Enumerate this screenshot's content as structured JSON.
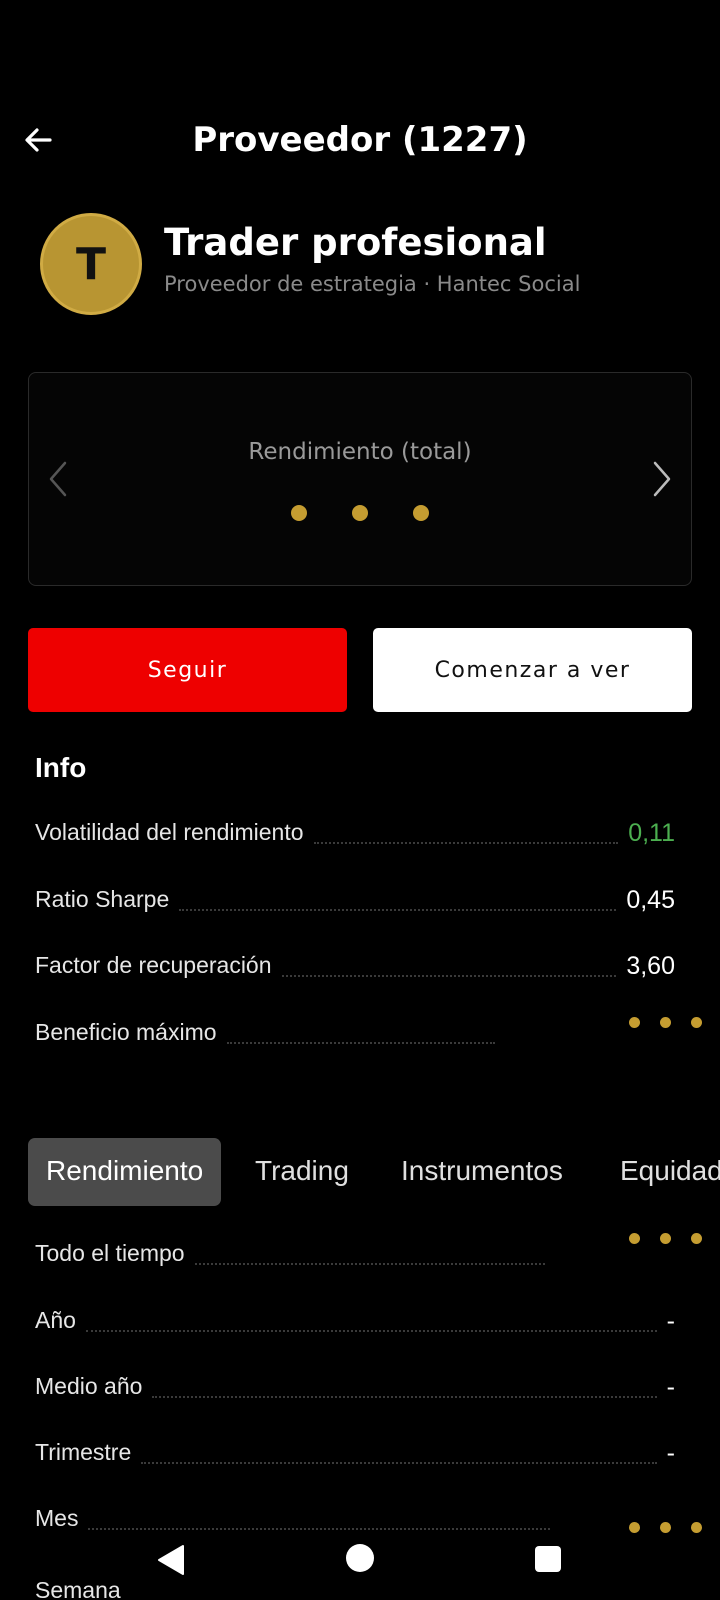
{
  "header": {
    "title": "Proveedor (1227)"
  },
  "provider": {
    "initial": "T",
    "name": "Trader profesional",
    "subtitle": "Proveedor de estrategia · Hantec Social"
  },
  "performance_card": {
    "title": "Rendimiento (total)"
  },
  "actions": {
    "follow_label": "Seguir",
    "watch_label": "Comenzar a ver"
  },
  "info": {
    "title": "Info",
    "rows": [
      {
        "label": "Volatilidad del rendimiento",
        "value": "0,11"
      },
      {
        "label": "Ratio Sharpe",
        "value": "0,45"
      },
      {
        "label": "Factor de recuperación",
        "value": "3,60"
      },
      {
        "label": "Beneficio máximo",
        "value": ""
      }
    ]
  },
  "tabs": [
    {
      "label": "Rendimiento"
    },
    {
      "label": "Trading"
    },
    {
      "label": "Instrumentos"
    },
    {
      "label": "Equidad"
    }
  ],
  "performance_rows": [
    {
      "label": "Todo el tiempo",
      "value": ""
    },
    {
      "label": "Año",
      "value": "-"
    },
    {
      "label": "Medio año",
      "value": "-"
    },
    {
      "label": "Trimestre",
      "value": "-"
    },
    {
      "label": "Mes",
      "value": ""
    },
    {
      "label": "Semana",
      "value": ""
    }
  ],
  "colors": {
    "accent_gold": "#c59d31",
    "follow_red": "#ee0000",
    "positive_green": "#4caf50",
    "background": "#000000"
  },
  "icons": {
    "back": "arrow-left-icon",
    "prev": "chevron-left-icon",
    "next": "chevron-right-icon",
    "loading": "loading-dots-icon",
    "nav_back": "triangle-back-icon",
    "nav_home": "circle-home-icon",
    "nav_recents": "square-recents-icon"
  }
}
